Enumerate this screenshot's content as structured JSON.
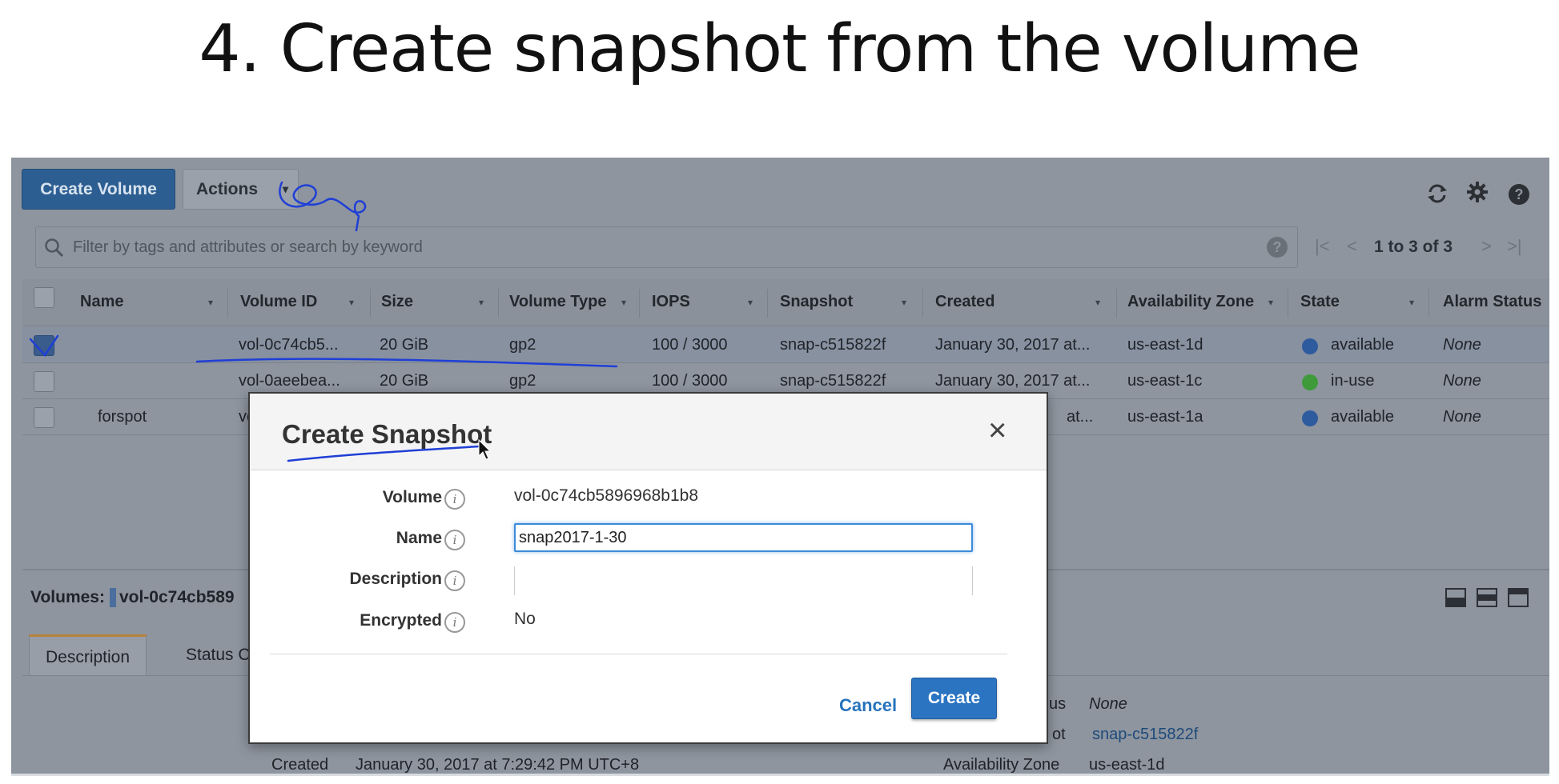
{
  "slide": {
    "title": "4. Create snapshot from the volume"
  },
  "toolbar": {
    "create_volume": "Create Volume",
    "actions": "Actions",
    "caret": "▾",
    "icons": [
      "refresh-icon",
      "gear-icon",
      "help-icon"
    ]
  },
  "search": {
    "placeholder": "Filter by tags and attributes or search by keyword",
    "help": "?"
  },
  "pager": {
    "first": "|<",
    "prev": "<",
    "text": "1 to 3 of 3",
    "next": ">",
    "last": ">|"
  },
  "table": {
    "headers": [
      "Name",
      "Volume ID",
      "Size",
      "Volume Type",
      "IOPS",
      "Snapshot",
      "Created",
      "Availability Zone",
      "State",
      "Alarm Status"
    ],
    "rows": [
      {
        "name": "",
        "volume_id": "vol-0c74cb5...",
        "size": "20 GiB",
        "type": "gp2",
        "iops": "100 / 3000",
        "snapshot": "snap-c515822f",
        "created": "January 30, 2017 at...",
        "az": "us-east-1d",
        "state": "available",
        "state_color": "#2e5a9e",
        "alarm": "None",
        "selected": true
      },
      {
        "name": "",
        "volume_id": "vol-0aeebea...",
        "size": "20 GiB",
        "type": "gp2",
        "iops": "100 / 3000",
        "snapshot": "snap-c515822f",
        "created": "January 30, 2017 at...",
        "az": "us-east-1c",
        "state": "in-use",
        "state_color": "#3f9a3a",
        "alarm": "None",
        "selected": false
      },
      {
        "name": "forspot",
        "volume_id": "vol",
        "size": "",
        "type": "",
        "iops": "",
        "snapshot": "",
        "created": "at...",
        "az": "us-east-1a",
        "state": "available",
        "state_color": "#2e5a9e",
        "alarm": "None",
        "selected": false
      }
    ]
  },
  "details": {
    "title_prefix": "Volumes:",
    "title_value": "vol-0c74cb589",
    "tabs": [
      "Description",
      "Status C"
    ],
    "fields": {
      "status_label": "us",
      "status_value": "None",
      "snapshot_label": "ot",
      "snapshot_value": "snap-c515822f",
      "created_label": "Created",
      "created_value": "January 30, 2017 at 7:29:42 PM UTC+8",
      "az_label": "Availability Zone",
      "az_value": "us-east-1d"
    }
  },
  "modal": {
    "title": "Create Snapshot",
    "close": "×",
    "info": "i",
    "volume_label": "Volume",
    "volume_value": "vol-0c74cb5896968b1b8",
    "name_label": "Name",
    "name_value": "snap2017-1-30",
    "description_label": "Description",
    "description_value": "",
    "encrypted_label": "Encrypted",
    "encrypted_value": "No",
    "cancel": "Cancel",
    "create": "Create"
  },
  "colors": {
    "accent": "#2b74c2",
    "annotation": "#1f3fd6",
    "overlay": "#8e959f"
  }
}
